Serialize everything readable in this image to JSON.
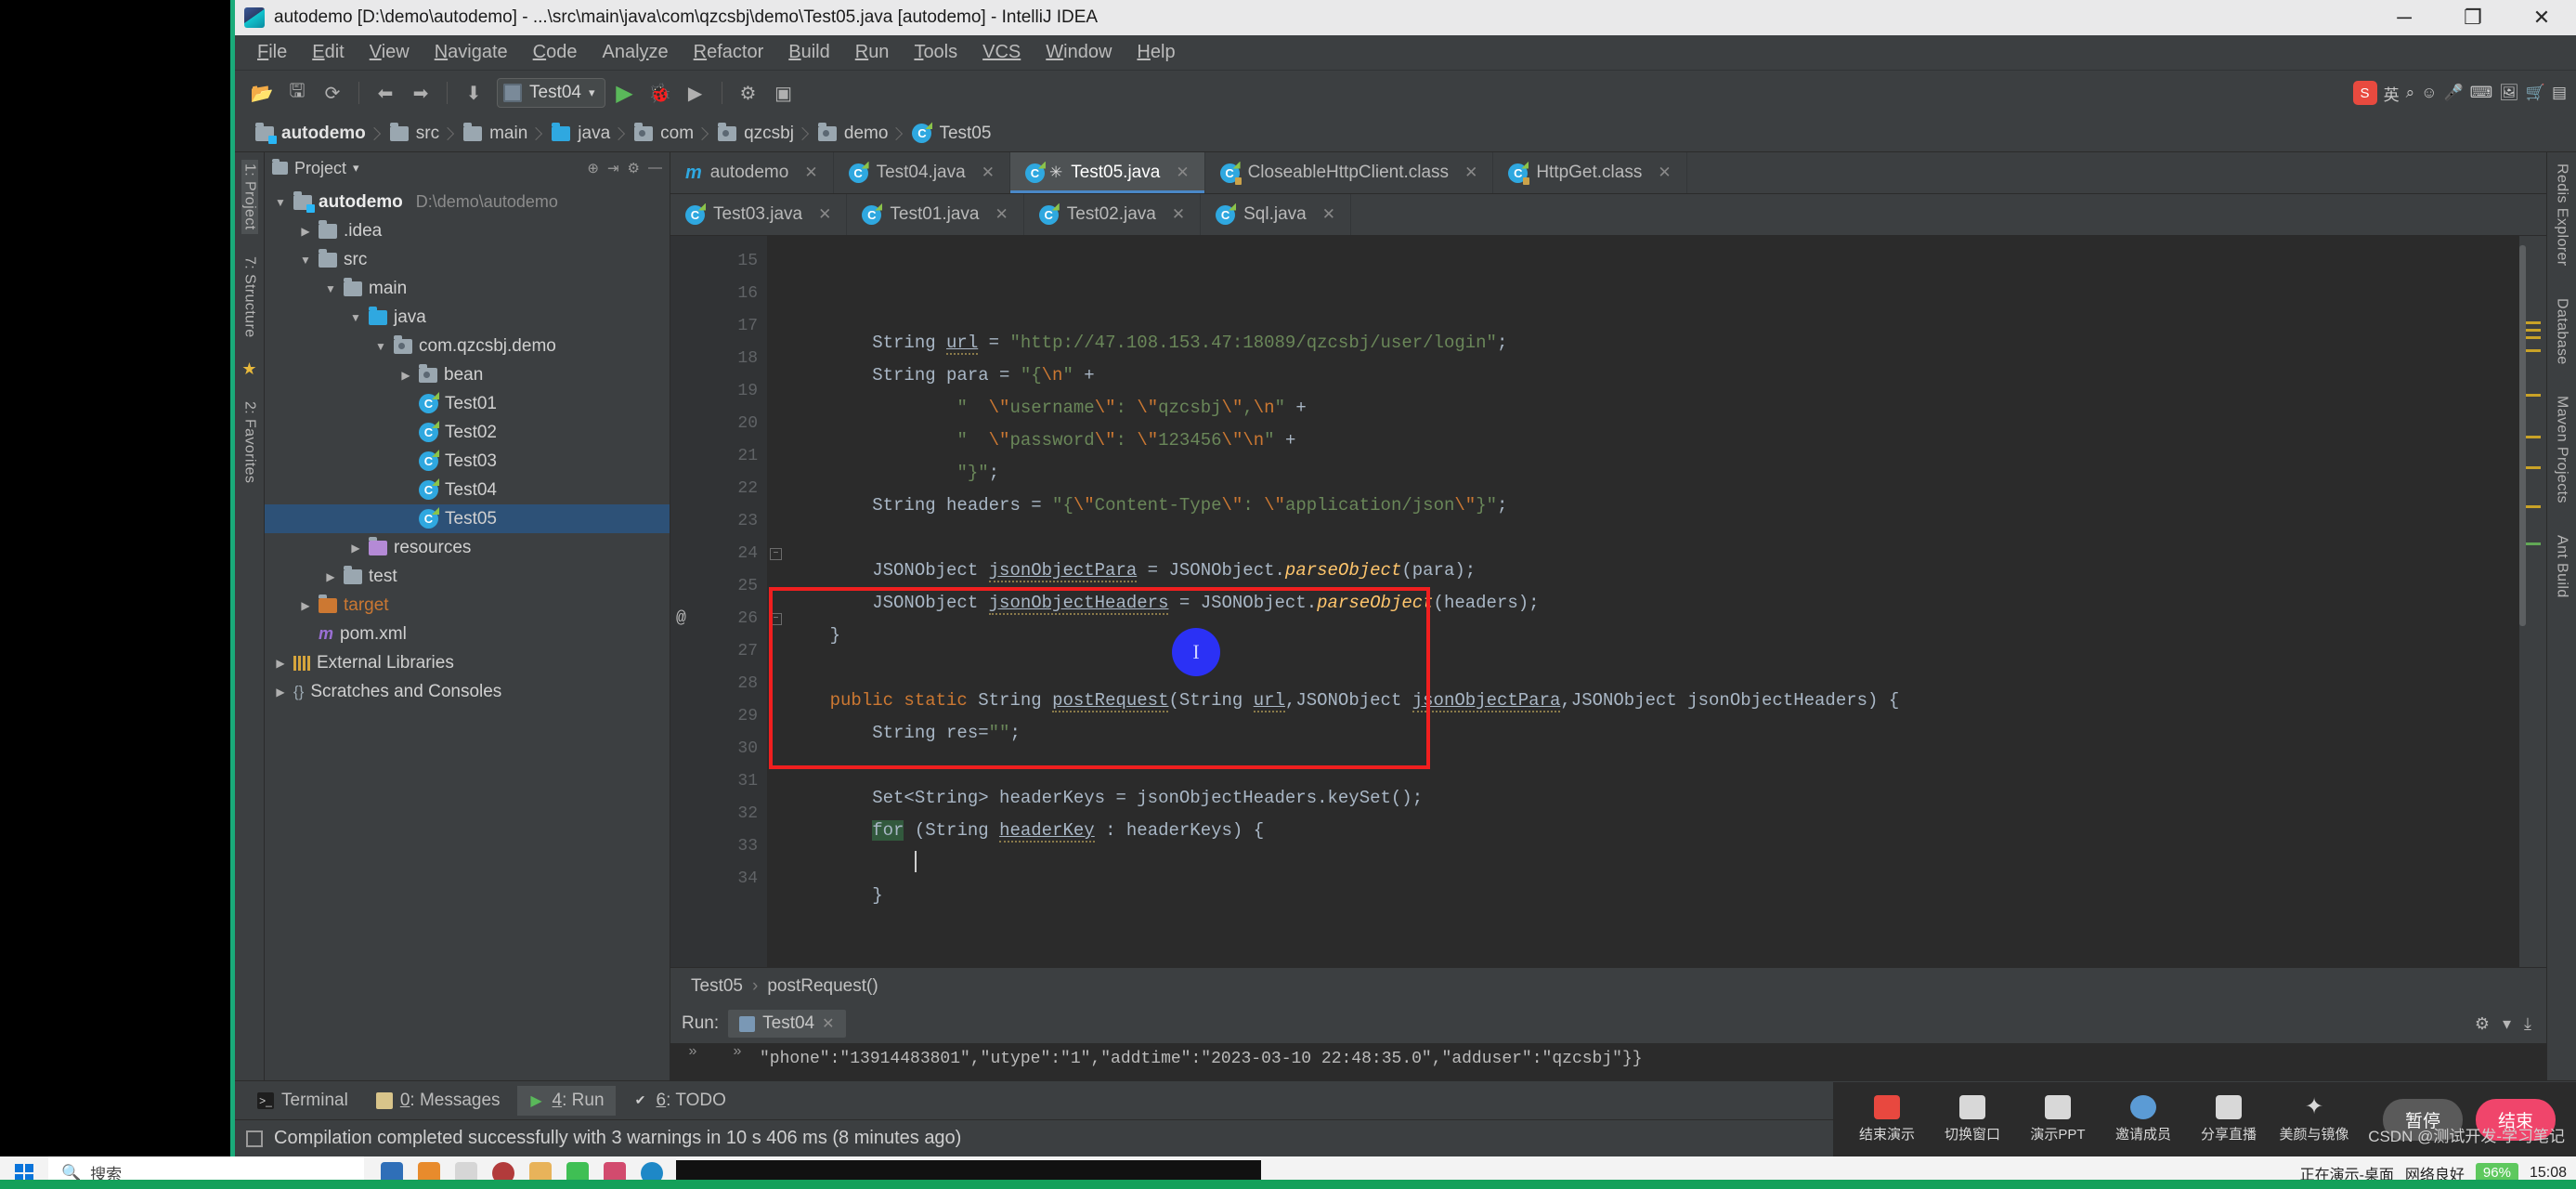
{
  "window": {
    "title": "autodemo [D:\\demo\\autodemo] - ...\\src\\main\\java\\com\\qzcsbj\\demo\\Test05.java [autodemo] - IntelliJ IDEA",
    "minimize": "─",
    "maximize": "❐",
    "close": "✕"
  },
  "menu": [
    {
      "pre": "F",
      "rest": "ile"
    },
    {
      "pre": "E",
      "rest": "dit"
    },
    {
      "pre": "V",
      "rest": "iew"
    },
    {
      "pre": "N",
      "rest": "avigate"
    },
    {
      "pre": "C",
      "rest": "ode"
    },
    {
      "pre": "Analy",
      "rest": "ze",
      "underline_last": true
    },
    {
      "pre": "R",
      "rest": "efactor"
    },
    {
      "pre": "B",
      "rest": "uild"
    },
    {
      "pre": "R",
      "rest": "un"
    },
    {
      "pre": "T",
      "rest": "ools"
    },
    {
      "pre": "VCS",
      "rest": ""
    },
    {
      "pre": "W",
      "rest": "indow"
    },
    {
      "pre": "H",
      "rest": "elp"
    }
  ],
  "toolbar": {
    "run_config": "Test04",
    "caret": "▾",
    "icons": [
      "open-folder",
      "save-all",
      "sync",
      "back",
      "forward",
      "compile"
    ],
    "right_icons": [
      "search-everywhere",
      "settings",
      "project-structure"
    ],
    "ime_label": "英"
  },
  "breadcrumb": [
    {
      "label": "autodemo",
      "icon": "module-folder-icon",
      "bold": true
    },
    {
      "label": "src",
      "icon": "folder-icon",
      "bold": false
    },
    {
      "label": "main",
      "icon": "folder-icon",
      "bold": false
    },
    {
      "label": "java",
      "icon": "source-folder-icon",
      "bold": false
    },
    {
      "label": "com",
      "icon": "package-icon",
      "bold": false
    },
    {
      "label": "qzcsbj",
      "icon": "package-icon",
      "bold": false
    },
    {
      "label": "demo",
      "icon": "package-icon",
      "bold": false
    },
    {
      "label": "Test05",
      "icon": "class-icon",
      "bold": false
    }
  ],
  "left_strip": [
    {
      "label": "1: Project",
      "selected": true
    },
    {
      "label": "7: Structure",
      "selected": false
    },
    {
      "label": "2: Favorites",
      "selected": false
    }
  ],
  "right_strip": [
    {
      "label": "Redis Explorer"
    },
    {
      "label": "Database"
    },
    {
      "label": "Maven Projects"
    },
    {
      "label": "Ant Build"
    }
  ],
  "project_panel": {
    "title": "Project",
    "title_caret": "▾",
    "tree": [
      {
        "indent": 0,
        "arrow": "▼",
        "icon": "module-folder-icon",
        "label": "autodemo",
        "bold": true,
        "path": "D:\\demo\\autodemo",
        "selected": false
      },
      {
        "indent": 1,
        "arrow": "▶",
        "icon": "folder-icon",
        "label": ".idea",
        "bold": false,
        "path": "",
        "selected": false
      },
      {
        "indent": 1,
        "arrow": "▼",
        "icon": "folder-icon",
        "label": "src",
        "bold": false,
        "path": "",
        "selected": false
      },
      {
        "indent": 2,
        "arrow": "▼",
        "icon": "folder-icon",
        "label": "main",
        "bold": false,
        "path": "",
        "selected": false
      },
      {
        "indent": 3,
        "arrow": "▼",
        "icon": "source-folder-icon",
        "label": "java",
        "bold": false,
        "path": "",
        "selected": false
      },
      {
        "indent": 4,
        "arrow": "▼",
        "icon": "package-icon",
        "label": "com.qzcsbj.demo",
        "bold": false,
        "path": "",
        "selected": false
      },
      {
        "indent": 5,
        "arrow": "▶",
        "icon": "package-icon",
        "label": "bean",
        "bold": false,
        "path": "",
        "selected": false
      },
      {
        "indent": 5,
        "arrow": "",
        "icon": "class-icon",
        "label": "Test01",
        "bold": false,
        "path": "",
        "selected": false
      },
      {
        "indent": 5,
        "arrow": "",
        "icon": "class-icon",
        "label": "Test02",
        "bold": false,
        "path": "",
        "selected": false
      },
      {
        "indent": 5,
        "arrow": "",
        "icon": "class-icon",
        "label": "Test03",
        "bold": false,
        "path": "",
        "selected": false
      },
      {
        "indent": 5,
        "arrow": "",
        "icon": "class-icon",
        "label": "Test04",
        "bold": false,
        "path": "",
        "selected": false
      },
      {
        "indent": 5,
        "arrow": "",
        "icon": "class-icon",
        "label": "Test05",
        "bold": false,
        "path": "",
        "selected": true
      },
      {
        "indent": 3,
        "arrow": "▶",
        "icon": "resource-folder-icon",
        "label": "resources",
        "bold": false,
        "path": "",
        "selected": false
      },
      {
        "indent": 2,
        "arrow": "▶",
        "icon": "folder-icon",
        "label": "test",
        "bold": false,
        "path": "",
        "selected": false
      },
      {
        "indent": 1,
        "arrow": "▶",
        "icon": "target-folder-icon",
        "label": "target",
        "bold": false,
        "path": "",
        "selected": false
      },
      {
        "indent": 1,
        "arrow": "",
        "icon": "maven-icon",
        "label": "pom.xml",
        "bold": false,
        "path": "",
        "selected": false
      },
      {
        "indent": 0,
        "arrow": "▶",
        "icon": "library-icon",
        "label": "External Libraries",
        "bold": false,
        "path": "",
        "selected": false
      },
      {
        "indent": 0,
        "arrow": "▶",
        "icon": "scratches-icon",
        "label": "Scratches and Consoles",
        "bold": false,
        "path": "",
        "selected": false
      }
    ]
  },
  "editor_tabs_row1": [
    {
      "label": "autodemo",
      "icon": "maven-module-icon",
      "active": false,
      "closable": true,
      "modified": false
    },
    {
      "label": "Test04.java",
      "icon": "class-icon",
      "active": false,
      "closable": true,
      "modified": false
    },
    {
      "label": "Test05.java",
      "icon": "class-icon",
      "active": true,
      "closable": true,
      "modified": true
    },
    {
      "label": "CloseableHttpClient.class",
      "icon": "class-locked-icon",
      "active": false,
      "closable": true,
      "modified": false
    },
    {
      "label": "HttpGet.class",
      "icon": "class-locked-icon",
      "active": false,
      "closable": true,
      "modified": false
    }
  ],
  "editor_tabs_row2": [
    {
      "label": "Test03.java",
      "icon": "class-icon",
      "active": false,
      "closable": true,
      "modified": false
    },
    {
      "label": "Test01.java",
      "icon": "class-icon",
      "active": false,
      "closable": true,
      "modified": false
    },
    {
      "label": "Test02.java",
      "icon": "class-icon",
      "active": false,
      "closable": true,
      "modified": false
    },
    {
      "label": "Sql.java",
      "icon": "class-icon",
      "active": false,
      "closable": true,
      "modified": false
    }
  ],
  "code": {
    "first_line_number": 15,
    "lines": [
      {
        "n": 15,
        "html": "        String <u class='warn'>url</u> = <span class='str'>\"http://47.108.153.47:18089/qzcsbj/user/login\"</span>;"
      },
      {
        "n": 16,
        "html": "        String para = <span class='str'>\"{</span><span class='esc'>\\n</span><span class='str'>\"</span> +"
      },
      {
        "n": 17,
        "html": "                <span class='str'>\"  </span><span class='esc'>\\\"</span><span class='str'>username</span><span class='esc'>\\\"</span><span class='str'>: </span><span class='esc'>\\\"</span><span class='str'>qzcsbj</span><span class='esc'>\\\"</span><span class='str'>,</span><span class='esc'>\\n</span><span class='str'>\"</span> +"
      },
      {
        "n": 18,
        "html": "                <span class='str'>\"  </span><span class='esc'>\\\"</span><span class='str'>password</span><span class='esc'>\\\"</span><span class='str'>: </span><span class='esc'>\\\"</span><span class='str'>123456</span><span class='esc'>\\\"</span><span class='esc'>\\n</span><span class='str'>\"</span> +"
      },
      {
        "n": 19,
        "html": "                <span class='str'>\"}\"</span>;"
      },
      {
        "n": 20,
        "html": "        String headers = <span class='str'>\"{</span><span class='esc'>\\\"</span><span class='str'>Content-Type</span><span class='esc'>\\\"</span><span class='str'>: </span><span class='esc'>\\\"</span><span class='str'>application/json</span><span class='esc'>\\\"</span><span class='str'>}\"</span>;"
      },
      {
        "n": 21,
        "html": ""
      },
      {
        "n": 22,
        "html": "        JSONObject <u class='warn'>jsonObjectPara</u> = JSONObject.<span class='fn'>parseObject</span>(para);"
      },
      {
        "n": 23,
        "html": "        JSONObject <u class='warn'>jsonObjectHeaders</u> = JSONObject.<span class='fn'>parseObject</span>(headers);"
      },
      {
        "n": 24,
        "html": "    }"
      },
      {
        "n": 25,
        "html": ""
      },
      {
        "n": 26,
        "html": "    <span class='kw'>public static</span> String <u class='warn'>postRequest</u>(String <u class='warn'>url</u>,JSONObject <u class='warn'>jsonObjectPara</u>,JSONObject jsonObjectHeaders) {"
      },
      {
        "n": 27,
        "html": "        String res=<span class='str'>\"\"</span>;"
      },
      {
        "n": 28,
        "html": ""
      },
      {
        "n": 29,
        "html": "        Set&lt;String&gt; headerKeys = jsonObjectHeaders.keySet();"
      },
      {
        "n": 30,
        "html": "        <span class='hl-for'>for</span> (String <u class='warn'>headerKey</u> : headerKeys) {"
      },
      {
        "n": 31,
        "html": "            <span class='caret-bar'></span>"
      },
      {
        "n": 32,
        "html": "        }"
      },
      {
        "n": 33,
        "html": ""
      },
      {
        "n": 34,
        "html": ""
      }
    ],
    "annotation_at_line": 26,
    "annotation_symbol": "@"
  },
  "member_breadcrumb": {
    "class": "Test05",
    "separator": "›",
    "method": "postRequest()"
  },
  "run_panel": {
    "label": "Run:",
    "tab": "Test04",
    "close": "✕",
    "expand1": "»",
    "expand2": "»",
    "output": "\"phone\":\"13914483801\",\"utype\":\"1\",\"addtime\":\"2023-03-10 22:48:35.0\",\"adduser\":\"qzcsbj\"}}",
    "gear": "⚙",
    "gear_caret": "▾",
    "download": "⤓"
  },
  "bottom_tabs": [
    {
      "label": "Terminal",
      "icon": "terminal-icon",
      "selected": false,
      "accel": ""
    },
    {
      "label": "0: Messages",
      "icon": "messages-icon",
      "selected": false,
      "accel": "0"
    },
    {
      "label": "4: Run",
      "icon": "run-icon",
      "selected": true,
      "accel": "4"
    },
    {
      "label": "6: TODO",
      "icon": "todo-icon",
      "selected": false,
      "accel": "6"
    }
  ],
  "status_bar": {
    "message": "Compilation completed successfully with 3 warnings in 10 s 406 ms (8 minutes ago)"
  },
  "meeting_bar": {
    "items": [
      {
        "label": "结束演示",
        "icon": "end-share-icon",
        "color": "#e8483f"
      },
      {
        "label": "切换窗口",
        "icon": "switch-window-icon",
        "color": "#d8d8d8"
      },
      {
        "label": "演示PPT",
        "icon": "present-ppt-icon",
        "color": "#d8d8d8"
      },
      {
        "label": "邀请成员",
        "icon": "invite-member-icon",
        "color": "#5b9bd5"
      },
      {
        "label": "分享直播",
        "icon": "share-live-icon",
        "color": "#d8d8d8"
      },
      {
        "label": "美颜与镜像",
        "icon": "beauty-mirror-icon",
        "color": "#d8d8d8"
      }
    ],
    "pause": "暂停",
    "end": "结束"
  },
  "taskbar": {
    "search_placeholder": "搜索",
    "search_icon": "search-icon",
    "start_icon": "windows-start-icon",
    "battery": "96",
    "battery_unit": "%",
    "time": "15:08",
    "weather": "正在演示-桌面",
    "network": "网络良好"
  },
  "watermark": "CSDN @测试开发-学习笔记"
}
